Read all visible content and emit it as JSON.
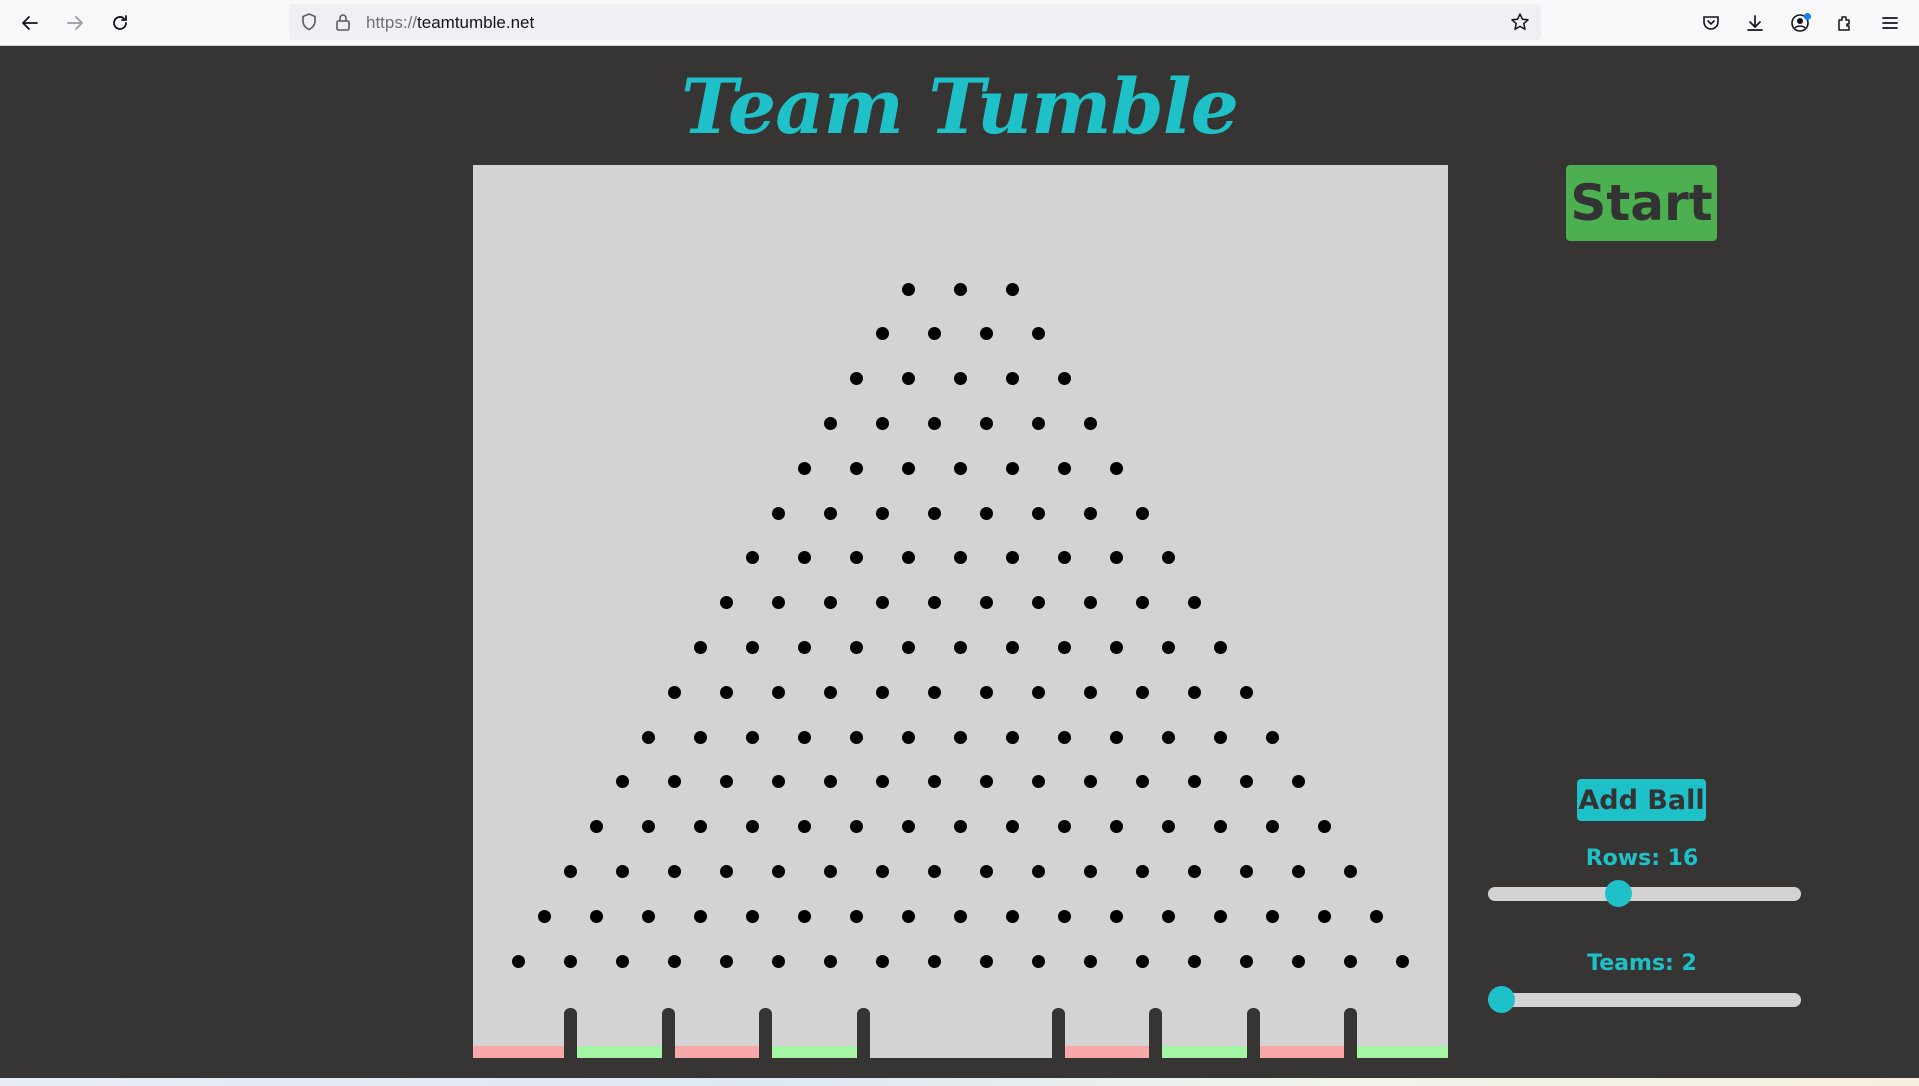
{
  "browser": {
    "url_scheme": "https://",
    "url_host": "teamtumble.net"
  },
  "page": {
    "title": "Team Tumble",
    "start_label": "Start",
    "add_ball_label": "Add Ball",
    "rows_label": "Rows: 16",
    "teams_label": "Teams: 2",
    "rows_value": 16,
    "rows_slider_fraction": 0.41,
    "teams_slider_fraction": 0.0
  },
  "colors": {
    "accent": "#1ec1c8",
    "start_button": "#4caf50",
    "board": "#d3d3d3",
    "background": "#363534",
    "bucket_red": "#f7a8a8",
    "bucket_green": "#a6f5a6"
  },
  "icons": [
    "back-arrow-icon",
    "forward-arrow-icon",
    "reload-icon",
    "shield-icon",
    "lock-icon",
    "star-icon",
    "pocket-icon",
    "download-icon",
    "account-icon",
    "extensions-icon",
    "menu-icon"
  ],
  "buckets": [
    "red",
    "green",
    "red",
    "green",
    "none",
    "none",
    "red",
    "green",
    "red",
    "green"
  ]
}
